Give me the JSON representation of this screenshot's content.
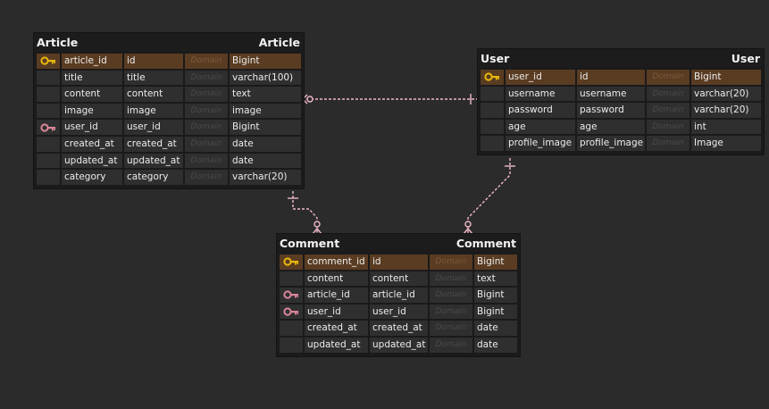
{
  "diagram": {
    "entities": [
      {
        "id": "article",
        "title_left": "Article",
        "title_right": "Article",
        "rows": [
          {
            "key": "primary",
            "logical": "article_id",
            "physical": "id",
            "domain": "Domain",
            "type": "Bigint"
          },
          {
            "key": "",
            "logical": "title",
            "physical": "title",
            "domain": "Domain",
            "type": "varchar(100)"
          },
          {
            "key": "",
            "logical": "content",
            "physical": "content",
            "domain": "Domain",
            "type": "text"
          },
          {
            "key": "",
            "logical": "image",
            "physical": "image",
            "domain": "Domain",
            "type": "image"
          },
          {
            "key": "foreign",
            "logical": "user_id",
            "physical": "user_id",
            "domain": "Domain",
            "type": "Bigint"
          },
          {
            "key": "",
            "logical": "created_at",
            "physical": "created_at",
            "domain": "Domain",
            "type": "date"
          },
          {
            "key": "",
            "logical": "updated_at",
            "physical": "updated_at",
            "domain": "Domain",
            "type": "date"
          },
          {
            "key": "",
            "logical": "category",
            "physical": "category",
            "domain": "Domain",
            "type": "varchar(20)"
          }
        ]
      },
      {
        "id": "user",
        "title_left": "User",
        "title_right": "User",
        "rows": [
          {
            "key": "primary",
            "logical": "user_id",
            "physical": "id",
            "domain": "Domain",
            "type": "Bigint"
          },
          {
            "key": "",
            "logical": "username",
            "physical": "username",
            "domain": "Domain",
            "type": "varchar(20)"
          },
          {
            "key": "",
            "logical": "password",
            "physical": "password",
            "domain": "Domain",
            "type": "varchar(20)"
          },
          {
            "key": "",
            "logical": "age",
            "physical": "age",
            "domain": "Domain",
            "type": "int"
          },
          {
            "key": "",
            "logical": "profile_image",
            "physical": "profile_image",
            "domain": "Domain",
            "type": "Image"
          }
        ]
      },
      {
        "id": "comment",
        "title_left": "Comment",
        "title_right": "Comment",
        "rows": [
          {
            "key": "primary",
            "logical": "comment_id",
            "physical": "id",
            "domain": "Domain",
            "type": "Bigint"
          },
          {
            "key": "",
            "logical": "content",
            "physical": "content",
            "domain": "Domain",
            "type": "text"
          },
          {
            "key": "foreign",
            "logical": "article_id",
            "physical": "article_id",
            "domain": "Domain",
            "type": "Bigint"
          },
          {
            "key": "foreign",
            "logical": "user_id",
            "physical": "user_id",
            "domain": "Domain",
            "type": "Bigint"
          },
          {
            "key": "",
            "logical": "created_at",
            "physical": "created_at",
            "domain": "Domain",
            "type": "date"
          },
          {
            "key": "",
            "logical": "updated_at",
            "physical": "updated_at",
            "domain": "Domain",
            "type": "date"
          }
        ]
      }
    ],
    "relationships": [
      {
        "from": "user",
        "to": "article",
        "style": "one-to-zero-or-many"
      },
      {
        "from": "article",
        "to": "comment",
        "style": "one-to-zero-or-many"
      },
      {
        "from": "user",
        "to": "comment",
        "style": "one-to-zero-or-many"
      }
    ]
  },
  "colors": {
    "background": "#2b2b2b",
    "primary_row": "#5a3c22",
    "primary_key_icon": "#e8b80c",
    "foreign_key_icon": "#d9869a",
    "relationship_line": "#f0b8c8"
  }
}
